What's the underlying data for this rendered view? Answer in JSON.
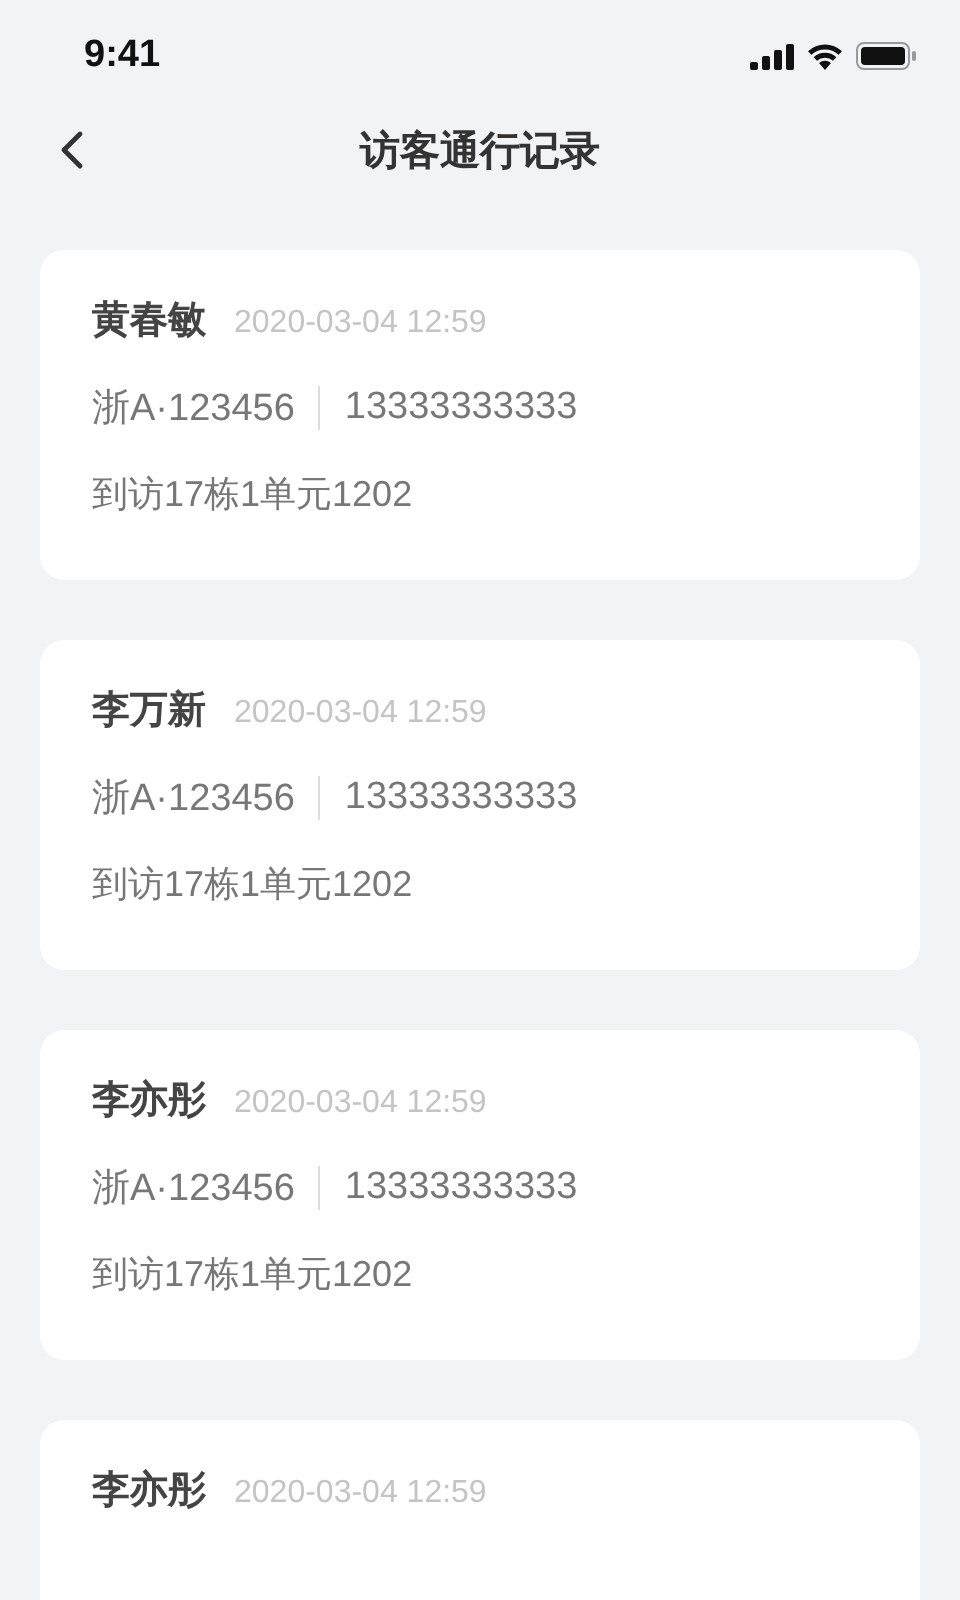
{
  "status_bar": {
    "time": "9:41"
  },
  "header": {
    "title": "访客通行记录"
  },
  "records": [
    {
      "name": "黄春敏",
      "time": "2020-03-04 12:59",
      "plate": "浙A·123456",
      "phone": "13333333333",
      "address": "到访17栋1单元1202"
    },
    {
      "name": "李万新",
      "time": "2020-03-04 12:59",
      "plate": "浙A·123456",
      "phone": "13333333333",
      "address": "到访17栋1单元1202"
    },
    {
      "name": "李亦彤",
      "time": "2020-03-04 12:59",
      "plate": "浙A·123456",
      "phone": "13333333333",
      "address": "到访17栋1单元1202"
    },
    {
      "name": "李亦彤",
      "time": "2020-03-04 12:59"
    }
  ]
}
